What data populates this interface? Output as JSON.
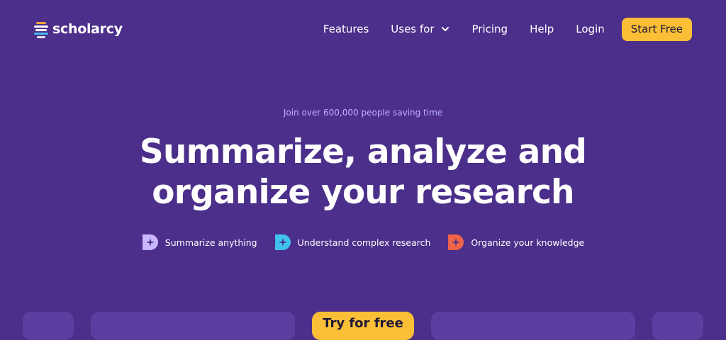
{
  "brand": {
    "name": "scholarcy"
  },
  "nav": {
    "features": "Features",
    "uses_for": "Uses for",
    "pricing": "Pricing",
    "help": "Help",
    "login": "Login",
    "start_free": "Start Free"
  },
  "hero": {
    "eyebrow": "Join over 600,000 people saving time",
    "headline_line1": "Summarize, analyze and",
    "headline_line2": "organize your research"
  },
  "features": [
    {
      "label": "Summarize anything",
      "icon": "sparkle-bubble-icon",
      "color": "#c9b8ff"
    },
    {
      "label": "Understand complex research",
      "icon": "sparkle-bubble-icon",
      "color": "#3fc2ee"
    },
    {
      "label": "Organize your knowledge",
      "icon": "sparkle-bubble-icon",
      "color": "#f0654a"
    }
  ],
  "cards": {
    "center_label": "Try for free"
  },
  "colors": {
    "background": "#4b2f8a",
    "accent": "#fbbf37",
    "eyebrow": "#bfb2ff"
  }
}
